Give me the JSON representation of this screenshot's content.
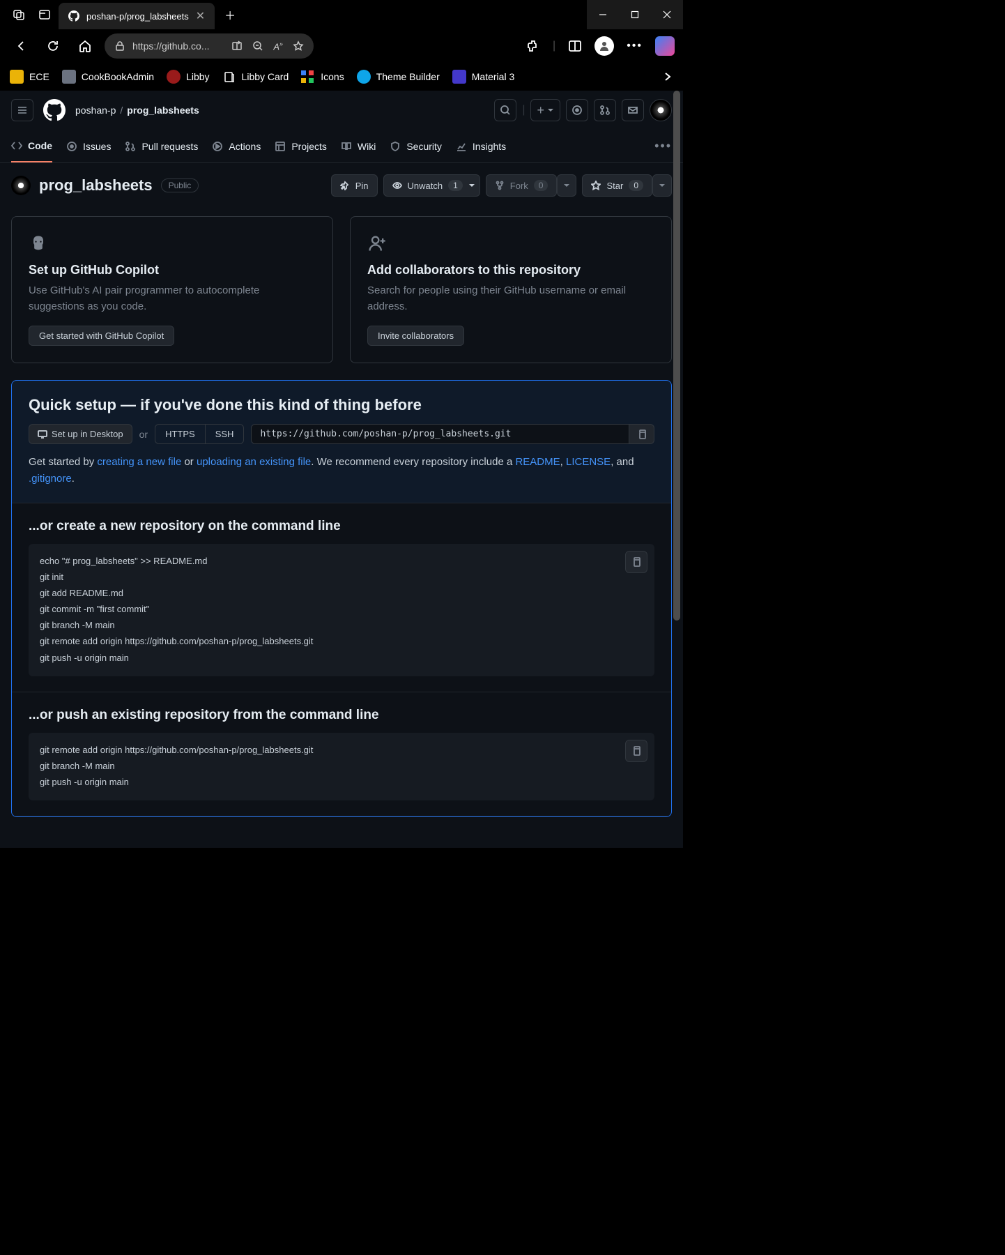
{
  "browser": {
    "tab_title": "poshan-p/prog_labsheets",
    "url_display": "https://github.co..."
  },
  "bookmarks": [
    {
      "label": "ECE",
      "icon_bg": "#eab308"
    },
    {
      "label": "CookBookAdmin",
      "icon_bg": "#6b7280"
    },
    {
      "label": "Libby",
      "icon_bg": "#991b1b"
    },
    {
      "label": "Libby Card",
      "icon_bg": "transparent"
    },
    {
      "label": "Icons",
      "icon_bg": "transparent"
    },
    {
      "label": "Theme Builder",
      "icon_bg": "#0ea5e9"
    },
    {
      "label": "Material 3",
      "icon_bg": "#4338ca"
    }
  ],
  "breadcrumb": {
    "owner": "poshan-p",
    "repo": "prog_labsheets"
  },
  "repo_nav": [
    {
      "label": "Code",
      "icon": "code"
    },
    {
      "label": "Issues",
      "icon": "issue"
    },
    {
      "label": "Pull requests",
      "icon": "pr"
    },
    {
      "label": "Actions",
      "icon": "play"
    },
    {
      "label": "Projects",
      "icon": "project"
    },
    {
      "label": "Wiki",
      "icon": "book"
    },
    {
      "label": "Security",
      "icon": "shield"
    },
    {
      "label": "Insights",
      "icon": "graph"
    }
  ],
  "repo": {
    "name": "prog_labsheets",
    "visibility": "Public",
    "pin": "Pin",
    "unwatch": "Unwatch",
    "unwatch_count": "1",
    "fork": "Fork",
    "fork_count": "0",
    "star": "Star",
    "star_count": "0"
  },
  "cards": {
    "copilot": {
      "title": "Set up GitHub Copilot",
      "desc": "Use GitHub's AI pair programmer to autocomplete suggestions as you code.",
      "btn": "Get started with GitHub Copilot"
    },
    "collab": {
      "title": "Add collaborators to this repository",
      "desc": "Search for people using their GitHub username or email address.",
      "btn": "Invite collaborators"
    }
  },
  "quick_setup": {
    "title": "Quick setup — if you've done this kind of thing before",
    "desktop_btn": "Set up in Desktop",
    "or": "or",
    "https": "HTTPS",
    "ssh": "SSH",
    "url": "https://github.com/poshan-p/prog_labsheets.git",
    "text_prefix": "Get started by ",
    "link_new_file": "creating a new file",
    "text_or": " or ",
    "link_upload": "uploading an existing file",
    "text_mid": ". We recommend every repository include a ",
    "link_readme": "README",
    "text_comma": ", ",
    "link_license": "LICENSE",
    "text_and": ", and ",
    "link_gitignore": ".gitignore",
    "text_period": "."
  },
  "create_section": {
    "title": "...or create a new repository on the command line",
    "code": "echo \"# prog_labsheets\" >> README.md\ngit init\ngit add README.md\ngit commit -m \"first commit\"\ngit branch -M main\ngit remote add origin https://github.com/poshan-p/prog_labsheets.git\ngit push -u origin main"
  },
  "push_section": {
    "title": "...or push an existing repository from the command line",
    "code": "git remote add origin https://github.com/poshan-p/prog_labsheets.git\ngit branch -M main\ngit push -u origin main"
  }
}
